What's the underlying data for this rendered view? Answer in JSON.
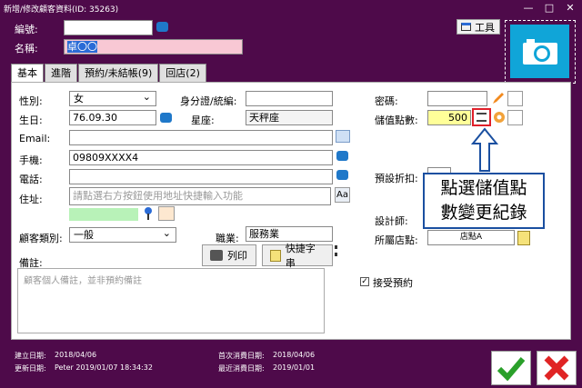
{
  "window": {
    "title": "新增/修改顧客資料(ID: 35263)",
    "minimize": "—",
    "maximize": "□",
    "close": "✕"
  },
  "header": {
    "number_label": "編號:",
    "number_value": "",
    "name_label": "名稱:",
    "name_value": "卓〇〇",
    "tool_label": "工具"
  },
  "tabs": [
    {
      "label": "基本",
      "active": true
    },
    {
      "label": "進階"
    },
    {
      "label": "預約/未結帳(9)"
    },
    {
      "label": "回店(2)"
    }
  ],
  "form": {
    "gender_label": "性別:",
    "gender_value": "女",
    "birthday_label": "生日:",
    "birthday_value": "76.09.30",
    "id_label": "身分證/統編:",
    "id_value": "",
    "zodiac_label": "星座:",
    "zodiac_value": "天秤座",
    "email_label": "Email:",
    "email_value": "",
    "mobile_label": "手機:",
    "mobile_value": "09809XXXX4",
    "phone_label": "電話:",
    "phone_value": "",
    "address_label": "住址:",
    "address_placeholder": "請點選右方按鈕使用地址快捷輸入功能",
    "category_label": "顧客類別:",
    "category_value": "一般",
    "job_label": "職業:",
    "job_value": "服務業",
    "print_label": "列印",
    "shortcut_label": "快捷字串",
    "note_label": "備註:",
    "note_placeholder": "顧客個人備註，並非預約備註",
    "password_label": "密碼:",
    "password_value": "",
    "points_label": "儲值點數:",
    "points_value": "500",
    "discount_label": "預設折扣:",
    "discount_value": "",
    "designer_label": "設計師:",
    "designer_value": "",
    "store_label": "所屬店點:",
    "store_value": "店點A",
    "accept_booking_label": "接受預約",
    "accept_booking_checked": true
  },
  "callout": {
    "line1": "點選儲值點",
    "line2": "數變更紀錄"
  },
  "footer": {
    "created_label": "建立日期:",
    "created_value": "2018/04/06",
    "updated_label": "更新日期:",
    "updated_value": "Peter 2019/01/07 18:34:32",
    "first_spend_label": "首次消費日期:",
    "first_spend_value": "2018/04/06",
    "last_spend_label": "最近消費日期:",
    "last_spend_value": "2019/01/01"
  },
  "colors": {
    "background": "#4e0a4a",
    "name_highlight": "#f8c8d4",
    "points_highlight": "#ffff99",
    "camera": "#10a5d8",
    "callout_border": "#1a4fa0"
  }
}
